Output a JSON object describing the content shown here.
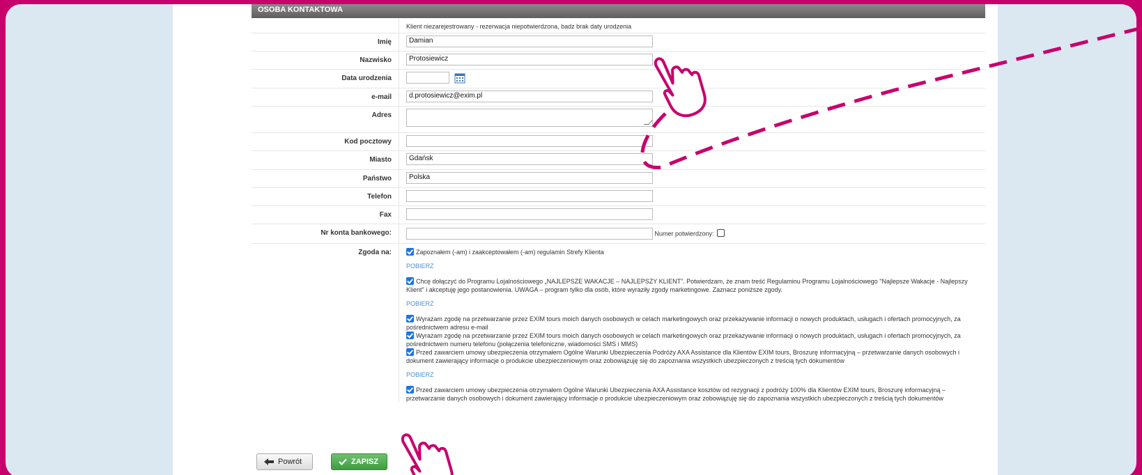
{
  "section_title": "OSOBA KONTAKTOWA",
  "notice": "Klient niezarejestrowany - rezerwacja niepotwierdzona, badz brak daty urodzenia",
  "fields": {
    "first_name": {
      "label": "Imię",
      "value": "Damian"
    },
    "last_name": {
      "label": "Nazwisko",
      "value": "Protosiewicz"
    },
    "birth_date": {
      "label": "Data urodzenia",
      "value": ""
    },
    "email": {
      "label": "e-mail",
      "value": "d.protosiewicz@exim.pl"
    },
    "address": {
      "label": "Adres",
      "value": ""
    },
    "postal_code": {
      "label": "Kod pocztowy",
      "value": ""
    },
    "city": {
      "label": "Miasto",
      "value": "Gdańsk"
    },
    "country": {
      "label": "Państwo",
      "value": "Polska"
    },
    "phone": {
      "label": "Telefon",
      "value": ""
    },
    "fax": {
      "label": "Fax",
      "value": ""
    },
    "bank_account": {
      "label": "Nr konta bankowego:",
      "value": "",
      "confirmed_label": "Numer potwierdzony:"
    }
  },
  "consent": {
    "label": "Zgoda na:",
    "download_label": "POBIERZ",
    "items": [
      "Zapoznałem (-am) i zaakceptowałem (-am) regulamin Strefy Klienta",
      "Chcę dołączyć do Programu Lojalnościowego „NAJLEPSZE WAKACJE – NAJLEPSZY KLIENT”. Potwierdzam, że znam treść Regulaminu Programu Lojalnościowego \"Najlepsze Wakacje - Najlepszy Klient\" i akceptuję jego postanowienia. UWAGA – program tylko dla osób, które wyraziły zgody marketingowe. Zaznacz poniższe zgody.",
      "Wyrażam zgodę na przetwarzanie przez EXIM tours moich danych osobowych w celach marketingowych oraz przekazywanie informacji o nowych produktach, usługach i ofertach promocyjnych, za pośrednictwem adresu e-mail",
      "Wyrażam zgodę na przetwarzanie przez EXIM tours moich danych osobowych w celach marketingowych oraz przekazywanie informacji o nowych produktach, usługach i ofertach promocyjnych, za pośrednictwem numeru telefonu (połączenia telefoniczne, wiadomości SMS i MMS)",
      "Przed zawarciem umowy ubezpieczenia otrzymałem Ogólne Warunki Ubezpieczenia Podróży AXA Assistance dla Klientów EXIM tours, Broszurę informacyjną – przetwarzanie danych osobowych i dokument zawierający informacje o produkcie ubezpieczeniowym oraz zobowiązuję się do zapoznania wszystkich ubezpieczonych z treścią tych dokumentów",
      "Przed zawarciem umowy ubezpieczenia otrzymałem Ogólne Warunki Ubezpieczenia AXA Assistance kosztów od rezygnacji z podróży 100% dla Klientów EXIM tours, Broszurę informacyjną – przetwarzanie danych osobowych i dokument zawierający informacje o produkcie ubezpieczeniowym oraz zobowiązuję się do zapoznania wszystkich ubezpieczonych z treścią tych dokumentów"
    ]
  },
  "buttons": {
    "back": "Powrót",
    "save": "ZAPISZ"
  },
  "icons": {
    "calendar": "calendar-icon",
    "back": "arrow-left-icon",
    "save": "checkmark-icon",
    "pointer": "hand-pointer-icon"
  },
  "colors": {
    "brand": "#c8006c",
    "header": "#6e6e6e",
    "link": "#4a8fcf",
    "save": "#4aa84a",
    "checkbox": "#1a73e8"
  }
}
